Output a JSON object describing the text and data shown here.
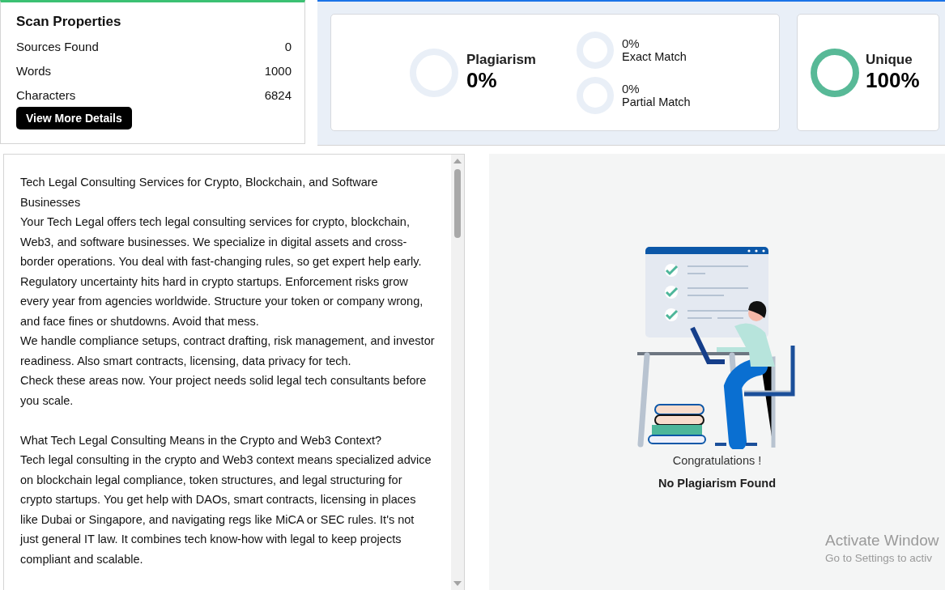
{
  "scan_properties": {
    "title": "Scan Properties",
    "rows": [
      {
        "label": "Sources Found",
        "value": "0"
      },
      {
        "label": "Words",
        "value": "1000"
      },
      {
        "label": "Characters",
        "value": "6824"
      }
    ],
    "button": "View More Details"
  },
  "results": {
    "main": {
      "label": "Plagiarism",
      "value": "0%",
      "color": "#e9eff7"
    },
    "sub": [
      {
        "value": "0%",
        "label": "Exact Match",
        "color": "#e9eff7"
      },
      {
        "value": "0%",
        "label": "Partial Match",
        "color": "#e9eff7"
      }
    ],
    "unique": {
      "label": "Unique",
      "value": "100%",
      "color": "#58b997"
    }
  },
  "text": {
    "paragraphs": [
      "Tech Legal Consulting Services for Crypto, Blockchain, and Software Businesses",
      "Your Tech Legal offers tech legal consulting services for crypto, blockchain, Web3, and software businesses. We specialize in digital assets and cross-border operations. You deal with fast-changing rules, so get expert help early.",
      "Regulatory uncertainty hits hard in crypto startups. Enforcement risks grow every year from agencies worldwide. Structure your token or company wrong, and face fines or shutdowns. Avoid that mess.",
      "We handle compliance setups, contract drafting, risk management, and investor readiness. Also smart contracts, licensing, data privacy for tech.",
      "Check these areas now. Your project needs solid legal tech consultants before you scale.",
      "What Tech Legal Consulting Means in the Crypto and Web3 Context?",
      "Tech legal consulting in the crypto and Web3 context means specialized advice on blockchain legal compliance, token structures, and legal structuring for crypto startups. You get help with DAOs, smart contracts, licensing in places like Dubai or Singapore, and navigating regs like MiCA or SEC rules. It's not just general IT law. It combines tech know-how with legal to keep projects compliant and scalable."
    ]
  },
  "result_message": {
    "title": "Congratulations !",
    "subtitle": "No Plagiarism Found"
  },
  "os_overlay": {
    "title": "Activate Window",
    "subtitle": "Go to Settings to activ"
  }
}
